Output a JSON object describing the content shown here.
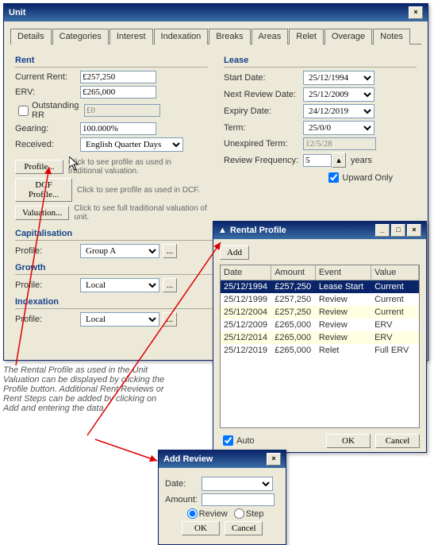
{
  "unit": {
    "title": "Unit",
    "tabs": [
      "Details",
      "Categories",
      "Interest",
      "Indexation",
      "Breaks",
      "Areas",
      "Relet",
      "Overage",
      "Notes"
    ],
    "active_tab": "Interest",
    "rent": {
      "heading": "Rent",
      "current_rent_lbl": "Current Rent:",
      "current_rent": "£257,250",
      "erv_lbl": "ERV:",
      "erv": "£265,000",
      "outstanding_rr_lbl": "Outstanding RR",
      "outstanding_rr": "£0",
      "gearing_lbl": "Gearing:",
      "gearing": "100.000%",
      "received_lbl": "Received:",
      "received": "English Quarter Days",
      "profile_btn": "Profile...",
      "profile_hint": "Click to see profile as used in traditional valuation.",
      "dcf_btn": "DCF Profile...",
      "dcf_hint": "Click to see profile as used in DCF.",
      "valuation_btn": "Valuation...",
      "valuation_hint": "Click to see full traditional valuation of unit."
    },
    "lease": {
      "heading": "Lease",
      "start_lbl": "Start Date:",
      "start": "25/12/1994",
      "next_lbl": "Next Review Date:",
      "next": "25/12/2009",
      "expiry_lbl": "Expiry Date:",
      "expiry": "24/12/2019",
      "term_lbl": "Term:",
      "term": "25/0/0",
      "unexp_lbl": "Unexpired Term:",
      "unexp": "12/5/28",
      "freq_lbl": "Review Frequency:",
      "freq": "5",
      "years": "years",
      "upward_lbl": "Upward Only"
    },
    "cap": {
      "heading": "Capitalisation",
      "profile_lbl": "Profile:",
      "profile": "Group A"
    },
    "growth": {
      "heading": "Growth",
      "profile_lbl": "Profile:",
      "profile": "Local"
    },
    "index": {
      "heading": "Indexation",
      "profile_lbl": "Profile:",
      "profile": "Local"
    }
  },
  "rental": {
    "title": "Rental Profile",
    "add_btn": "Add",
    "headers": [
      "Date",
      "Amount",
      "Event",
      "Value"
    ],
    "rows": [
      {
        "date": "25/12/1994",
        "amount": "£257,250",
        "event": "Lease Start",
        "value": "Current"
      },
      {
        "date": "25/12/1999",
        "amount": "£257,250",
        "event": "Review",
        "value": "Current"
      },
      {
        "date": "25/12/2004",
        "amount": "£257,250",
        "event": "Review",
        "value": "Current"
      },
      {
        "date": "25/12/2009",
        "amount": "£265,000",
        "event": "Review",
        "value": "ERV"
      },
      {
        "date": "25/12/2014",
        "amount": "£265,000",
        "event": "Review",
        "value": "ERV"
      },
      {
        "date": "25/12/2019",
        "amount": "£265,000",
        "event": "Relet",
        "value": "Full ERV"
      }
    ],
    "auto_lbl": "Auto",
    "ok_btn": "OK",
    "cancel_btn": "Cancel"
  },
  "addrev": {
    "title": "Add Review",
    "date_lbl": "Date:",
    "amount_lbl": "Amount:",
    "review_lbl": "Review",
    "step_lbl": "Step",
    "ok_btn": "OK",
    "cancel_btn": "Cancel"
  },
  "explain": "The Rental Profile as used in the Unit Valuation can be displayed by clicking the Profile button. Additional Rent Reviews or Rent Steps can be added by clicking on Add and entering the data."
}
